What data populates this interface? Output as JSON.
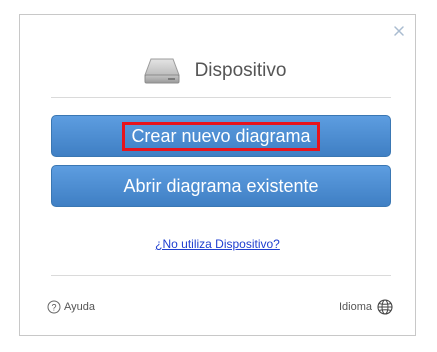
{
  "dialog": {
    "title": "Dispositivo",
    "close_icon": "close-icon",
    "device_icon": "hard-drive-icon"
  },
  "actions": {
    "create_label": "Crear nuevo diagrama",
    "open_label": "Abrir diagrama existente",
    "create_highlighted": true
  },
  "link": {
    "text": "¿No utiliza Dispositivo?"
  },
  "footer": {
    "help_label": "Ayuda",
    "help_icon": "help-circle-icon",
    "language_label": "Idioma",
    "language_icon": "globe-icon"
  },
  "colors": {
    "button_top": "#5d9de0",
    "button_bottom": "#3f7fc4",
    "highlight": "#e8141c",
    "link": "#1f3fd0"
  }
}
